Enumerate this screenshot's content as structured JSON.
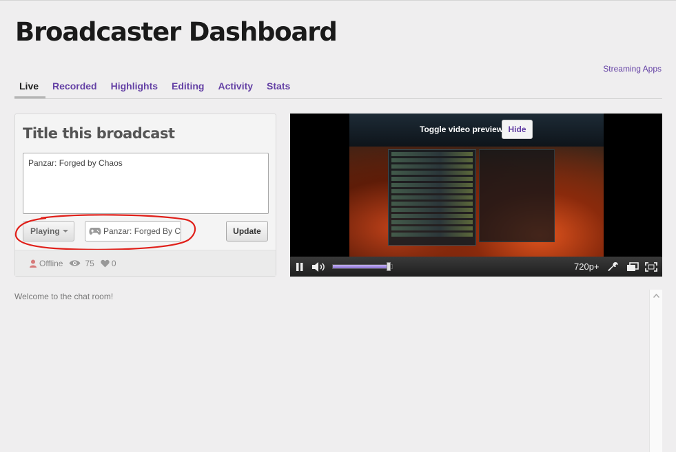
{
  "page": {
    "title": "Broadcaster Dashboard"
  },
  "header": {
    "streaming_apps_link": "Streaming Apps"
  },
  "tabs": [
    {
      "label": "Live",
      "active": true
    },
    {
      "label": "Recorded",
      "active": false
    },
    {
      "label": "Highlights",
      "active": false
    },
    {
      "label": "Editing",
      "active": false
    },
    {
      "label": "Activity",
      "active": false
    },
    {
      "label": "Stats",
      "active": false
    }
  ],
  "broadcast_panel": {
    "heading": "Title this broadcast",
    "title_value": "Panzar: Forged by Chaos",
    "activity_select": "Playing",
    "game_value": "Panzar: Forged By Chaos",
    "update_button": "Update",
    "status": "Offline",
    "viewers": "75",
    "likes": "0",
    "annotation_color": "#e0201a"
  },
  "video": {
    "toggle_label": "Toggle video preview:",
    "hide_button": "Hide",
    "quality": "720p+",
    "volume_level": 0.95
  },
  "chat": {
    "welcome_text": "Welcome to the chat room!"
  },
  "colors": {
    "accent": "#6441a5",
    "background": "#efeeef"
  }
}
